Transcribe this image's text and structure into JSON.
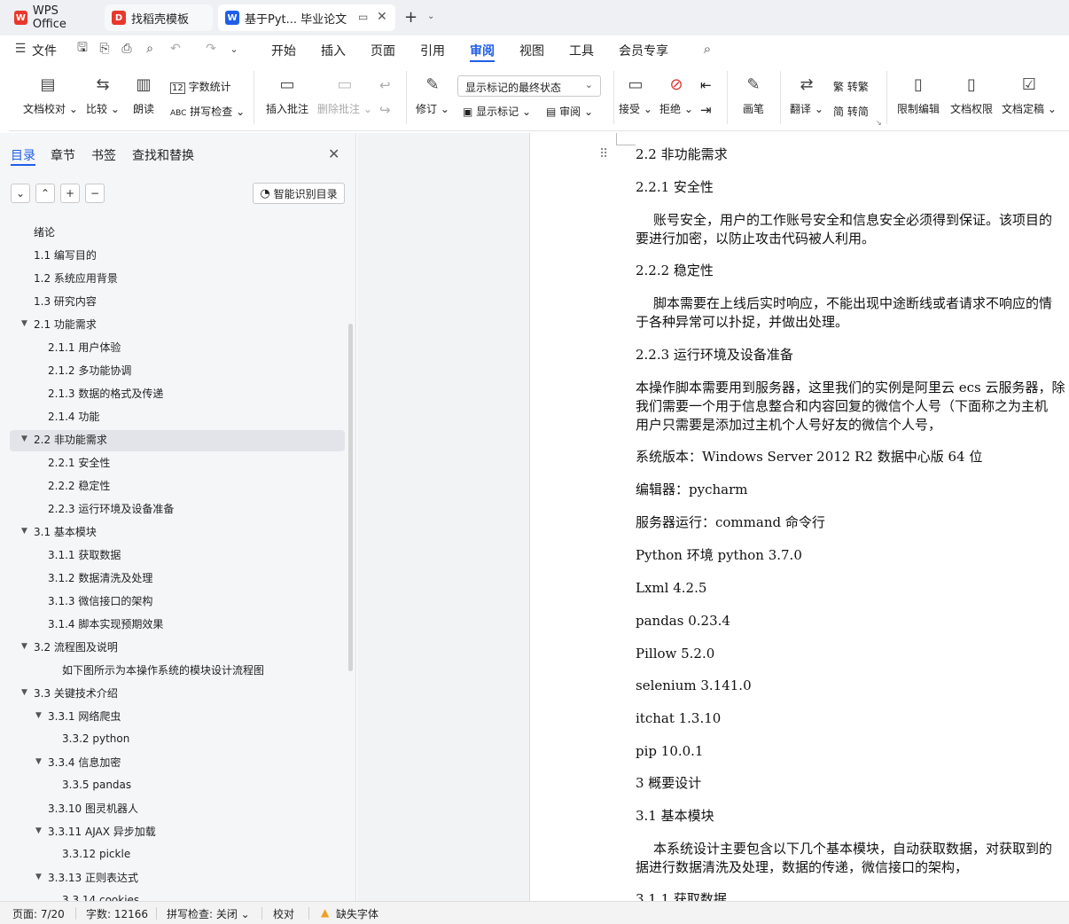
{
  "tabs": {
    "wps": "WPS Office",
    "template": "找稻壳模板",
    "doc": "基于Pyt... 毕业论文"
  },
  "menu": {
    "file": "文件",
    "items": [
      "开始",
      "插入",
      "页面",
      "引用",
      "审阅",
      "视图",
      "工具",
      "会员专享"
    ],
    "active": "审阅"
  },
  "ribbon": {
    "proofread": "文档校对",
    "compare": "比较",
    "read_aloud": "朗读",
    "word_count": "字数统计",
    "spell_check": "拼写检查",
    "insert_comment": "插入批注",
    "delete_comment": "删除批注",
    "track": "修订",
    "markup_select": "显示标记的最终状态",
    "show_markup": "显示标记",
    "review": "审阅",
    "accept": "接受",
    "reject": "拒绝",
    "pen": "画笔",
    "translate": "翻译",
    "to_traditional": "转繁",
    "to_simplified": "转简",
    "restrict_edit": "限制编辑",
    "doc_permission": "文档权限",
    "finalize": "文档定稿"
  },
  "nav": {
    "tabs": [
      "目录",
      "章节",
      "书签",
      "查找和替换"
    ],
    "smart_toc": "智能识别目录",
    "toc": [
      {
        "label": "绪论",
        "level": 0,
        "caret": false
      },
      {
        "label": "1.1 编写目的",
        "level": 0,
        "caret": false
      },
      {
        "label": "1.2 系统应用背景",
        "level": 0,
        "caret": false
      },
      {
        "label": "1.3 研究内容",
        "level": 0,
        "caret": false
      },
      {
        "label": "2.1 功能需求",
        "level": 0,
        "caret": true
      },
      {
        "label": "2.1.1 用户体验",
        "level": 1,
        "caret": false
      },
      {
        "label": "2.1.2 多功能协调",
        "level": 1,
        "caret": false
      },
      {
        "label": "2.1.3 数据的格式及传递",
        "level": 1,
        "caret": false
      },
      {
        "label": "2.1.4  功能",
        "level": 1,
        "caret": false
      },
      {
        "label": "2.2 非功能需求",
        "level": 0,
        "caret": true,
        "selected": true
      },
      {
        "label": "2.2.1 安全性",
        "level": 1,
        "caret": false
      },
      {
        "label": "2.2.2 稳定性",
        "level": 1,
        "caret": false
      },
      {
        "label": "2.2.3 运行环境及设备准备",
        "level": 1,
        "caret": false
      },
      {
        "label": "3.1 基本模块",
        "level": 0,
        "caret": true
      },
      {
        "label": "3.1.1 获取数据",
        "level": 1,
        "caret": false
      },
      {
        "label": "3.1.2 数据清洗及处理",
        "level": 1,
        "caret": false
      },
      {
        "label": "3.1.3 微信接口的架构",
        "level": 1,
        "caret": false
      },
      {
        "label": "3.1.4 脚本实现预期效果",
        "level": 1,
        "caret": false
      },
      {
        "label": "3.2 流程图及说明",
        "level": 0,
        "caret": true
      },
      {
        "label": "如下图所示为本操作系统的模块设计流程图",
        "level": 2,
        "caret": false
      },
      {
        "label": "3.3  关键技术介绍",
        "level": 0,
        "caret": true
      },
      {
        "label": "3.3.1 网络爬虫",
        "level": 1,
        "caret": true
      },
      {
        "label": "3.3.2 python",
        "level": 2,
        "caret": false
      },
      {
        "label": "3.3.4 信息加密",
        "level": 1,
        "caret": true
      },
      {
        "label": "3.3.5 pandas",
        "level": 2,
        "caret": false
      },
      {
        "label": "3.3.10 图灵机器人",
        "level": 1,
        "caret": false
      },
      {
        "label": "3.3.11 AJAX 异步加载",
        "level": 1,
        "caret": true
      },
      {
        "label": "3.3.12 pickle",
        "level": 2,
        "caret": false
      },
      {
        "label": "3.3.13  正则表达式",
        "level": 1,
        "caret": true
      },
      {
        "label": "3.3.14 cookies",
        "level": 2,
        "caret": false
      }
    ]
  },
  "doc": {
    "lines": [
      {
        "text": "2.2 非功能需求",
        "indent": false
      },
      {
        "text": "2.2.1 安全性",
        "indent": false
      },
      {
        "text": "账号安全，用户的工作账号安全和信息安全必须得到保证。该项目的",
        "indent": true
      },
      {
        "text": "要进行加密，以防止攻击代码被人利用。",
        "indent": false
      },
      {
        "text": "2.2.2 稳定性",
        "indent": false
      },
      {
        "text": "脚本需要在上线后实时响应，不能出现中途断线或者请求不响应的情",
        "indent": true
      },
      {
        "text": "于各种异常可以扑捉，并做出处理。",
        "indent": false
      },
      {
        "text": "2.2.3 运行环境及设备准备",
        "indent": false
      },
      {
        "text": "本操作脚本需要用到服务器，这里我们的实例是阿里云 ecs 云服务器，除",
        "indent": false
      },
      {
        "text": "我们需要一个用于信息整合和内容回复的微信个人号（下面称之为主机",
        "indent": false
      },
      {
        "text": "用户只需要是添加过主机个人号好友的微信个人号，",
        "indent": false
      },
      {
        "text": "系统版本：Windows Server 2012 R2  数据中心版  64 位",
        "indent": false
      },
      {
        "text": "编辑器：pycharm",
        "indent": false
      },
      {
        "text": "服务器运行：command 命令行",
        "indent": false
      },
      {
        "text": "Python 环境  python 3.7.0",
        "indent": false
      },
      {
        "text": "Lxml 4.2.5",
        "indent": false
      },
      {
        "text": "pandas 0.23.4",
        "indent": false
      },
      {
        "text": "Pillow 5.2.0",
        "indent": false
      },
      {
        "text": "selenium  3.141.0",
        "indent": false
      },
      {
        "text": "itchat 1.3.10",
        "indent": false
      },
      {
        "text": "pip 10.0.1",
        "indent": false
      },
      {
        "text": "3 概要设计",
        "indent": false
      },
      {
        "text": "3.1 基本模块",
        "indent": false
      },
      {
        "text": "本系统设计主要包含以下几个基本模块，自动获取数据，对获取到的",
        "indent": true
      },
      {
        "text": "据进行数据清洗及处理，数据的传递，微信接口的架构，",
        "indent": false
      },
      {
        "text": "3.1.1 获取数据",
        "indent": false
      }
    ]
  },
  "status": {
    "page": "页面: 7/20",
    "words": "字数: 12166",
    "spell": "拼写检查: 关闭",
    "proof": "校对",
    "missing_font": "缺失字体"
  },
  "colors": {
    "accent": "#1f5ee8",
    "wps_red": "#e8382d",
    "warning": "#f0a020"
  }
}
